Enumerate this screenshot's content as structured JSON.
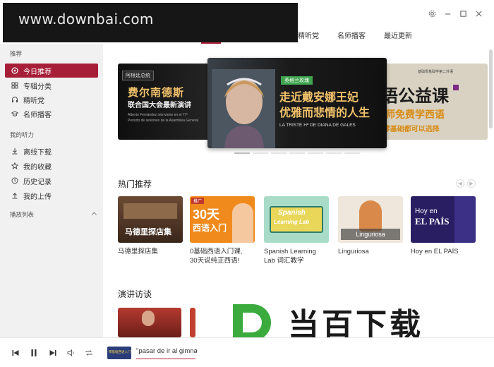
{
  "watermark": "www.downbai.com",
  "top_tabs": [
    "精听党",
    "名师播客",
    "最近更新"
  ],
  "sidebar": {
    "section_recommend": "推荐",
    "items": [
      {
        "label": "今日推荐",
        "icon": "today-icon",
        "active": true
      },
      {
        "label": "专辑分类",
        "icon": "grid-icon"
      },
      {
        "label": "精听党",
        "icon": "headphones-icon"
      },
      {
        "label": "名师播客",
        "icon": "graduation-cap-icon"
      }
    ],
    "section_mine": "我的听力",
    "my_items": [
      {
        "label": "离线下载",
        "icon": "download-icon"
      },
      {
        "label": "我的收藏",
        "icon": "star-icon"
      },
      {
        "label": "历史记录",
        "icon": "clock-icon"
      },
      {
        "label": "我的上传",
        "icon": "upload-icon"
      }
    ],
    "playlist_label": "播放列表"
  },
  "banner": {
    "left_badge": "阿根廷总统",
    "left_title_1": "费尔南德斯",
    "left_title_2": "联合国大会最新演讲",
    "left_sub_1": "Alberto Fernández interviene en el 77º",
    "left_sub_2": "Periodo de sesiones de la Asamblea General",
    "center_badge": "英格兰玫瑰",
    "center_title_1": "走近戴安娜王妃",
    "center_title_2": "优雅而悲情的人生",
    "center_sub": "LA TRISTE Hª DE DIANA DE GALES",
    "right_small": "基础零基础学第二外语",
    "right_title": "语公益课",
    "right_line_2": "老师免费学西语",
    "right_line_3": "/非零基础都可以选择"
  },
  "hot_section_title": "热门推荐",
  "hot_cards": [
    {
      "title_1": "马德里探店集",
      "title_2": "",
      "overlay": "马德里探店集"
    },
    {
      "title_1": "0基础西语入门课,",
      "title_2": "30天说纯正西语!",
      "overlay_badge": "推广",
      "overlay_1": "30天",
      "overlay_2": "西语入门"
    },
    {
      "title_1": "Spanish Learning",
      "title_2": "Lab 词汇教学",
      "overlay_1": "Spanish",
      "overlay_2": "Learning Lab"
    },
    {
      "title_1": "Linguriosa",
      "title_2": "",
      "overlay": "Linguriosa"
    },
    {
      "title_1": "Hoy en EL PAÍS",
      "title_2": "",
      "overlay_1": "Hoy en",
      "overlay_2": "EL PAÍS"
    }
  ],
  "talk_section_title": "演讲访谈",
  "logo_text": "当百下载",
  "player": {
    "track_title": "\"pasar de ir al gimnasio",
    "thumb_text": "零基础西语入门"
  },
  "colors": {
    "accent": "#a61e37",
    "logo_green": "#3bab3e"
  }
}
